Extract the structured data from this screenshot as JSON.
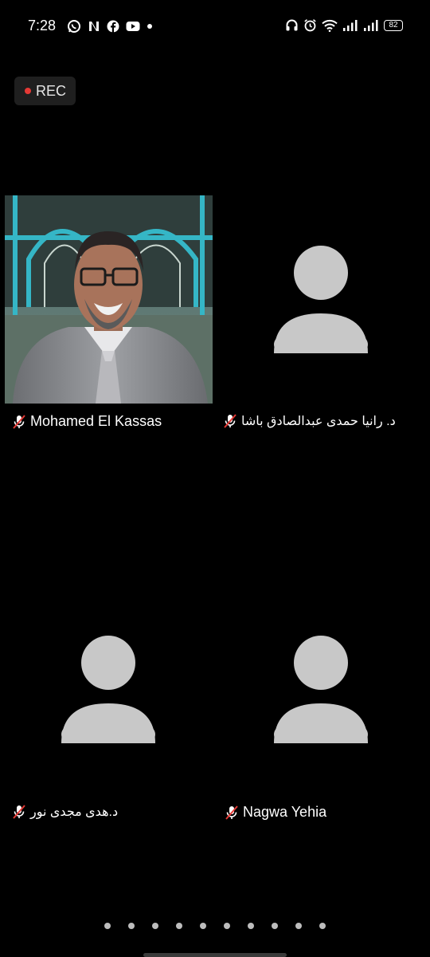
{
  "status_bar": {
    "time": "7:28",
    "battery": "82",
    "left_icons": [
      "whatsapp-icon",
      "netflix-icon",
      "facebook-icon",
      "youtube-icon",
      "dot-icon"
    ],
    "right_icons": [
      "headphones-icon",
      "alarm-icon",
      "wifi-icon",
      "signal-icon",
      "signal-icon",
      "battery-icon"
    ]
  },
  "recording": {
    "label": "REC",
    "color": "#e53935"
  },
  "participants": [
    {
      "name": "Mohamed El Kassas",
      "has_video": true,
      "muted": true
    },
    {
      "name": "د. رانيا حمدى عبدالصادق باشا",
      "has_video": false,
      "muted": true
    },
    {
      "name": "د.هدى مجدى نور",
      "has_video": false,
      "muted": true
    },
    {
      "name": "Nagwa Yehia",
      "has_video": false,
      "muted": true
    }
  ],
  "pager": {
    "total_pages": 10
  },
  "colors": {
    "avatar": "#c8c8c8",
    "mute_slash": "#e53935",
    "background": "#000000"
  }
}
